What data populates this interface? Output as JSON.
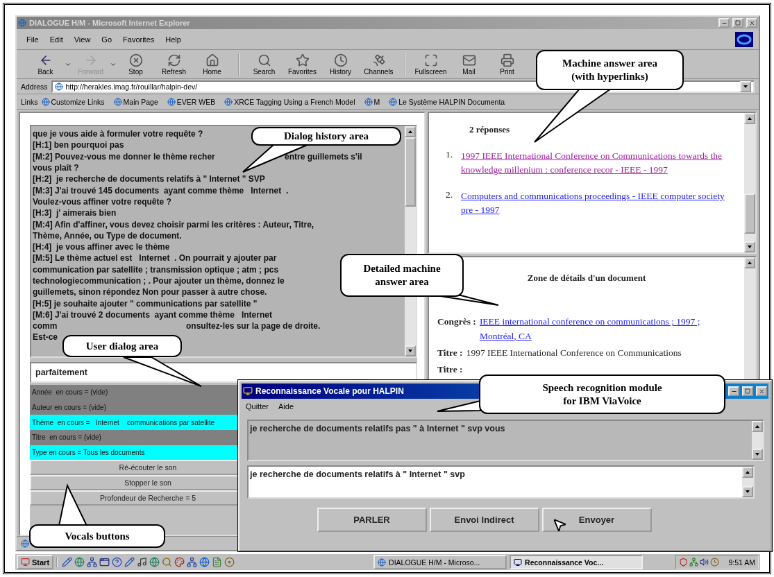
{
  "browser": {
    "title": "DIALOGUE H/M - Microsoft Internet Explorer",
    "menu": [
      "File",
      "Edit",
      "View",
      "Go",
      "Favorites",
      "Help"
    ],
    "toolbar_groups": [
      [
        {
          "kind": "back",
          "label": "Back",
          "disabled": false
        },
        {
          "kind": "forward",
          "label": "Forward",
          "disabled": true
        },
        {
          "kind": "stop",
          "label": "Stop",
          "disabled": false
        },
        {
          "kind": "refresh",
          "label": "Refresh",
          "disabled": false
        },
        {
          "kind": "home",
          "label": "Home",
          "disabled": false
        }
      ],
      [
        {
          "kind": "search",
          "label": "Search",
          "disabled": false
        },
        {
          "kind": "favorites",
          "label": "Favorites",
          "disabled": false
        },
        {
          "kind": "history",
          "label": "History",
          "disabled": false
        },
        {
          "kind": "channels",
          "label": "Channels",
          "disabled": false
        }
      ],
      [
        {
          "kind": "fullscreen",
          "label": "Fullscreen",
          "disabled": false
        },
        {
          "kind": "mail",
          "label": "Mail",
          "disabled": false
        },
        {
          "kind": "print",
          "label": "Print",
          "disabled": false
        }
      ]
    ],
    "address": {
      "label": "Address",
      "value": "http://herakles.imag.fr/rouillar/halpin-dev/"
    },
    "links": {
      "label": "Links",
      "items": [
        "Customize Links",
        "Main Page",
        "EVER WEB",
        "XRCE Tagging Using a French Model",
        "M",
        "Le Système HALPIN Documenta"
      ]
    }
  },
  "history": {
    "lines": [
      {
        "segments": [
          "que je vous aide à formuler votre requête ?"
        ]
      },
      {
        "segments": [
          "[H:1] ben pourquoi pas"
        ]
      },
      {
        "segments": [
          "[M:2] Pouvez-vous me donner le thème recher",
          "entre guillemets s'il"
        ]
      },
      {
        "segments": [
          "vous plaît ?"
        ]
      },
      {
        "segments": [
          "[H:2]  je recherche de documents relatifs à \" Internet \" SVP"
        ]
      },
      {
        "segments": [
          "[M:3] J'ai trouvé 145 documents  ayant comme thème   Internet  ."
        ]
      },
      {
        "segments": [
          "Voulez-vous affiner votre requête ?"
        ]
      },
      {
        "segments": [
          "[H:3]  j' aimerais bien"
        ]
      },
      {
        "segments": [
          "[M:4] Afin d'affiner, vous devez choisir parmi les critères : Auteur, Titre,"
        ]
      },
      {
        "segments": [
          "Thème, Année, ou Type de document."
        ]
      },
      {
        "segments": [
          "[H:4]  je vous affiner avec le thème"
        ]
      },
      {
        "segments": [
          "[M:5] Le thème actuel est   Internet  . On pourrait y ajouter par"
        ]
      },
      {
        "segments": [
          "communication par satellite ; transmission optique ; atm ; pcs"
        ]
      },
      {
        "segments": [
          "technologiecommunication ; . Pour ajouter un thème, donnez le"
        ]
      },
      {
        "segments": [
          "guillemets, sinon répondez Non pour passer à autre chose."
        ]
      },
      {
        "segments": [
          "[H:5] je souhaite ajouter \" communications par satellite \""
        ]
      },
      {
        "segments": [
          "[M:6] J'ai trouvé 2 documents  ayant comme thème   Internet"
        ]
      },
      {
        "segments": [
          "comm",
          "onsultez-les sur la page de droite."
        ]
      },
      {
        "segments": [
          "Est-ce"
        ]
      }
    ]
  },
  "user_input": {
    "value": "parfaitement"
  },
  "criteria": [
    {
      "text": "Année  en cours = (vide)",
      "set": false
    },
    {
      "text": "Auteur en cours = (vide)",
      "set": false
    },
    {
      "text": "Thème  en cours =   Internet    communications par satellite",
      "set": true
    },
    {
      "text": "Titre  en cours = (vide)",
      "set": false
    },
    {
      "text": "Type en cours = Tous les documents",
      "set": true
    }
  ],
  "vocal_buttons": [
    "Ré-écouter le son",
    "Stopper le son",
    "Profondeur de Recherche = 5"
  ],
  "answers": {
    "heading": "2 réponses",
    "items": [
      {
        "number": "1.",
        "text": "1997 IEEE International Conference on Communications towards the knowledge millenium : conference recor - IEEE - 1997",
        "visited": true
      },
      {
        "number": "2.",
        "text": "Computers and communications proceedings - IEEE computer society pre - 1997",
        "visited": false
      }
    ]
  },
  "details": {
    "heading": "Zone de détails d'un document",
    "fields": [
      {
        "label": "Congrès :",
        "value": "IEEE international conference on communications ; 1997 ; Montréal, CA",
        "kind": "link"
      },
      {
        "label": "Titre :",
        "value": "1997 IEEE International Conference on Communications",
        "kind": "text"
      },
      {
        "label": "Titre :"
      }
    ]
  },
  "speech_dialog": {
    "title": "Reconnaissance Vocale pour HALPIN",
    "menu": [
      "Quitter",
      "Aide"
    ],
    "recognized": "je recherche de documents relatifs pas \" à Internet \" svp vous",
    "edited": "je recherche de documents relatifs à \" Internet \" svp",
    "buttons": [
      "PARLER",
      "Envoi Indirect",
      "Envoyer"
    ]
  },
  "taskbar": {
    "start": "Start",
    "tasks": [
      {
        "label": "DIALOGUE H/M - Microso...",
        "selected": false
      },
      {
        "label": "Reconnaissance Voc...",
        "selected": true
      }
    ],
    "clock": "9:51 AM"
  },
  "callouts": [
    {
      "text": "Machine answer area\n(with hyperlinks)"
    },
    {
      "text": "Dialog history area"
    },
    {
      "text": "Detailed machine\nanswer area"
    },
    {
      "text": "User dialog area"
    },
    {
      "text": "Speech recognition module\nfor IBM ViaVoice"
    },
    {
      "text": "Vocals buttons"
    }
  ]
}
